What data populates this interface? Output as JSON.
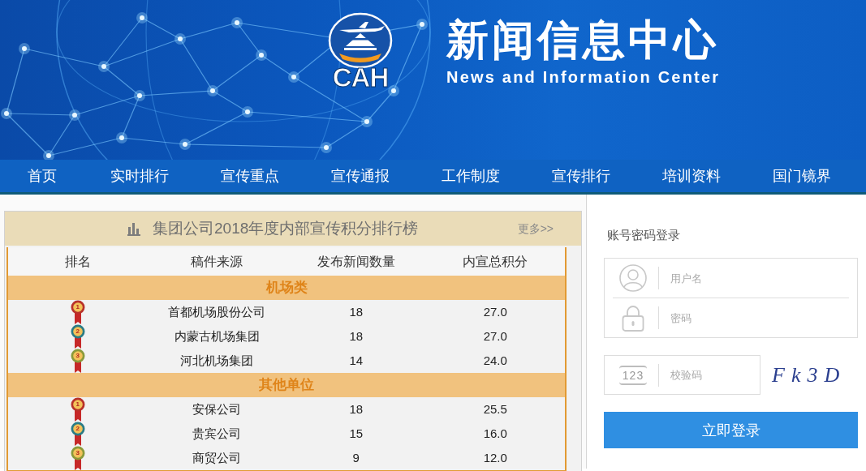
{
  "header": {
    "logo_text": "CAH",
    "title": "新闻信息中心",
    "subtitle": "News and Information Center"
  },
  "nav": [
    "首页",
    "实时排行",
    "宣传重点",
    "宣传通报",
    "工作制度",
    "宣传排行",
    "培训资料",
    "国门镜界"
  ],
  "ranking_panel": {
    "title": "集团公司2018年度内部宣传积分排行榜",
    "more_link": "更多>>",
    "columns": [
      "排名",
      "稿件来源",
      "发布新闻数量",
      "内宣总积分"
    ],
    "groups": [
      {
        "name": "机场类",
        "rows": [
          {
            "rank": "1",
            "color": "#b8322a",
            "source": "首都机场股份公司",
            "news_count": "18",
            "total_points": "27.0"
          },
          {
            "rank": "2",
            "color": "#2a7c86",
            "source": "内蒙古机场集团",
            "news_count": "18",
            "total_points": "27.0"
          },
          {
            "rank": "3",
            "color": "#8a9a3a",
            "source": "河北机场集团",
            "news_count": "14",
            "total_points": "24.0"
          }
        ]
      },
      {
        "name": "其他单位",
        "rows": [
          {
            "rank": "1",
            "color": "#b8322a",
            "source": "安保公司",
            "news_count": "18",
            "total_points": "25.5"
          },
          {
            "rank": "2",
            "color": "#2a7c86",
            "source": "贵宾公司",
            "news_count": "15",
            "total_points": "16.0"
          },
          {
            "rank": "3",
            "color": "#8a9a3a",
            "source": "商贸公司",
            "news_count": "9",
            "total_points": "12.0"
          }
        ]
      }
    ]
  },
  "login": {
    "title": "账号密码登录",
    "username": {
      "placeholder": "用户名"
    },
    "password": {
      "placeholder": "密码"
    },
    "captcha": {
      "icon_text": "123",
      "placeholder": "校验码",
      "image_text": "Fk3D"
    },
    "submit_button": "立即登录"
  }
}
